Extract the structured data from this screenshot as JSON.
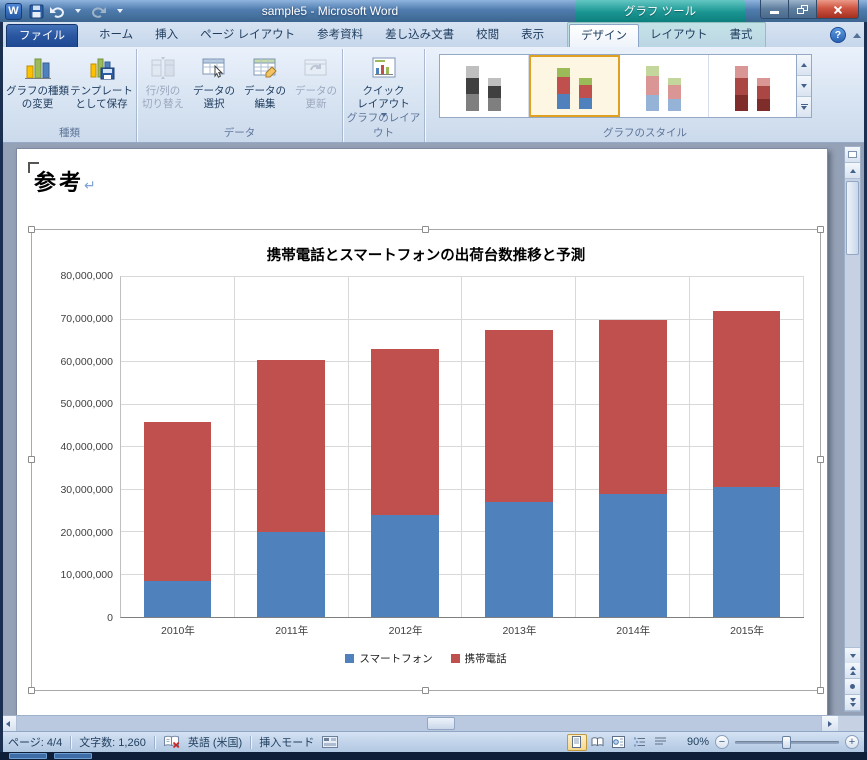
{
  "titlebar": {
    "title": "sample5 - Microsoft Word",
    "context_title": "グラフ ツール"
  },
  "ribbon": {
    "file_tab": "ファイル",
    "help_label": "?",
    "tabs": [
      {
        "label": "ホーム"
      },
      {
        "label": "挿入"
      },
      {
        "label": "ページ レイアウト"
      },
      {
        "label": "参考資料"
      },
      {
        "label": "差し込み文書"
      },
      {
        "label": "校閲"
      },
      {
        "label": "表示"
      }
    ],
    "context_tabs": [
      {
        "label": "デザイン",
        "active": true
      },
      {
        "label": "レイアウト",
        "active": false
      },
      {
        "label": "書式",
        "active": false
      }
    ],
    "groups": {
      "type": {
        "label": "種類",
        "change_chart_type": {
          "line1": "グラフの種類",
          "line2": "の変更"
        },
        "save_template": {
          "line1": "テンプレート",
          "line2": "として保存"
        }
      },
      "data": {
        "label": "データ",
        "switch_row_col": {
          "line1": "行/列の",
          "line2": "切り替え"
        },
        "select_data": {
          "line1": "データの",
          "line2": "選択"
        },
        "edit_data": {
          "line1": "データの",
          "line2": "編集"
        },
        "refresh_data": {
          "line1": "データの",
          "line2": "更新"
        }
      },
      "chart_layouts": {
        "label": "グラフのレイアウト",
        "quick_layout": {
          "line1": "クイック",
          "line2": "レイアウト"
        }
      },
      "chart_styles": {
        "label": "グラフのスタイル",
        "thumbnails": [
          {
            "selected": false,
            "columns": [
              {
                "height": 92,
                "segments": [
                  {
                    "color": "#bfbfbf",
                    "h": 26
                  },
                  {
                    "color": "#404040",
                    "h": 36
                  },
                  {
                    "color": "#7f7f7f",
                    "h": 38
                  }
                ]
              },
              {
                "height": 68,
                "segments": [
                  {
                    "color": "#bfbfbf",
                    "h": 26
                  },
                  {
                    "color": "#404040",
                    "h": 36
                  },
                  {
                    "color": "#7f7f7f",
                    "h": 38
                  }
                ]
              }
            ]
          },
          {
            "selected": true,
            "columns": [
              {
                "height": 92,
                "segments": [
                  {
                    "color": "#9bbb59",
                    "h": 22
                  },
                  {
                    "color": "#c0504d",
                    "h": 42
                  },
                  {
                    "color": "#4f81bd",
                    "h": 36
                  }
                ]
              },
              {
                "height": 68,
                "segments": [
                  {
                    "color": "#9bbb59",
                    "h": 22
                  },
                  {
                    "color": "#c0504d",
                    "h": 42
                  },
                  {
                    "color": "#4f81bd",
                    "h": 36
                  }
                ]
              }
            ]
          },
          {
            "selected": false,
            "columns": [
              {
                "height": 92,
                "segments": [
                  {
                    "color": "#c3d69b",
                    "h": 22
                  },
                  {
                    "color": "#d99694",
                    "h": 42
                  },
                  {
                    "color": "#95b3d7",
                    "h": 36
                  }
                ]
              },
              {
                "height": 68,
                "segments": [
                  {
                    "color": "#c3d69b",
                    "h": 22
                  },
                  {
                    "color": "#d99694",
                    "h": 42
                  },
                  {
                    "color": "#95b3d7",
                    "h": 36
                  }
                ]
              }
            ]
          },
          {
            "selected": false,
            "columns": [
              {
                "height": 92,
                "segments": [
                  {
                    "color": "#d99694",
                    "h": 26
                  },
                  {
                    "color": "#aa4643",
                    "h": 38
                  },
                  {
                    "color": "#7f2d2a",
                    "h": 36
                  }
                ]
              },
              {
                "height": 68,
                "segments": [
                  {
                    "color": "#d99694",
                    "h": 26
                  },
                  {
                    "color": "#aa4643",
                    "h": 38
                  },
                  {
                    "color": "#7f2d2a",
                    "h": 36
                  }
                ]
              }
            ]
          }
        ]
      }
    }
  },
  "document": {
    "heading": "参考",
    "paragraph_mark": "↵"
  },
  "chart_data": {
    "type": "bar",
    "stacked": true,
    "title": "携帯電話とスマートフォンの出荷台数推移と予測",
    "categories": [
      "2010年",
      "2011年",
      "2012年",
      "2013年",
      "2014年",
      "2015年"
    ],
    "series": [
      {
        "name": "スマートフォン",
        "color": "#4f81bd",
        "values": [
          8500000,
          20000000,
          24000000,
          27000000,
          29000000,
          30500000
        ]
      },
      {
        "name": "携帯電話",
        "color": "#c0504d",
        "values": [
          37500000,
          40500000,
          39000000,
          40500000,
          41000000,
          41500000
        ]
      }
    ],
    "ylim": [
      0,
      80000000
    ],
    "ytick_interval": 10000000,
    "ytick_labels": [
      "0",
      "10,000,000",
      "20,000,000",
      "30,000,000",
      "40,000,000",
      "50,000,000",
      "60,000,000",
      "70,000,000",
      "80,000,000"
    ],
    "grid": true,
    "legend_position": "bottom"
  },
  "status_bar": {
    "page": "ページ: 4/4",
    "word_count": "文字数: 1,260",
    "language": "英語 (米国)",
    "insert_mode": "挿入モード",
    "zoom_level": "90%",
    "zoom_out": "−",
    "zoom_in": "+"
  }
}
